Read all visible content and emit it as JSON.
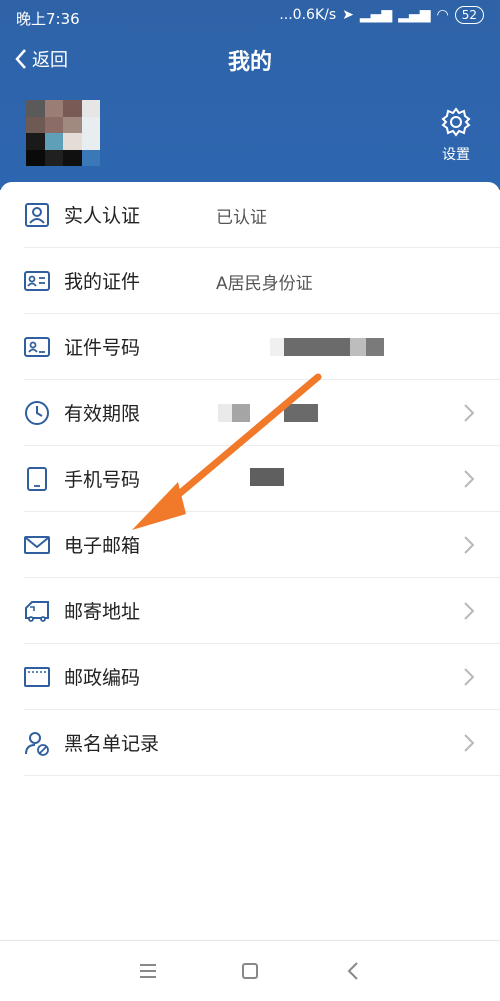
{
  "status": {
    "time": "晚上7:36",
    "speed": "...0.6K/s",
    "battery": "52"
  },
  "nav": {
    "back_label": "返回",
    "title": "我的"
  },
  "header": {
    "settings_label": "设置"
  },
  "rows": [
    {
      "label": "实人认证",
      "value": "已认证",
      "icon": "person-id-icon"
    },
    {
      "label": "我的证件",
      "value": "A居民身份证",
      "icon": "id-card-icon"
    },
    {
      "label": "证件号码",
      "value": "",
      "icon": "id-number-icon"
    },
    {
      "label": "有效期限",
      "value": "",
      "icon": "clock-icon"
    },
    {
      "label": "手机号码",
      "value": "",
      "icon": "phone-icon"
    },
    {
      "label": "电子邮箱",
      "value": "",
      "icon": "mail-icon"
    },
    {
      "label": "邮寄地址",
      "value": "",
      "icon": "truck-icon"
    },
    {
      "label": "邮政编码",
      "value": "",
      "icon": "postcode-icon"
    },
    {
      "label": "黑名单记录",
      "value": "",
      "icon": "blacklist-user-icon"
    }
  ],
  "colors": {
    "header": "#2f63a8",
    "accent": "#f07a2a",
    "icon": "#2f5f9e"
  }
}
